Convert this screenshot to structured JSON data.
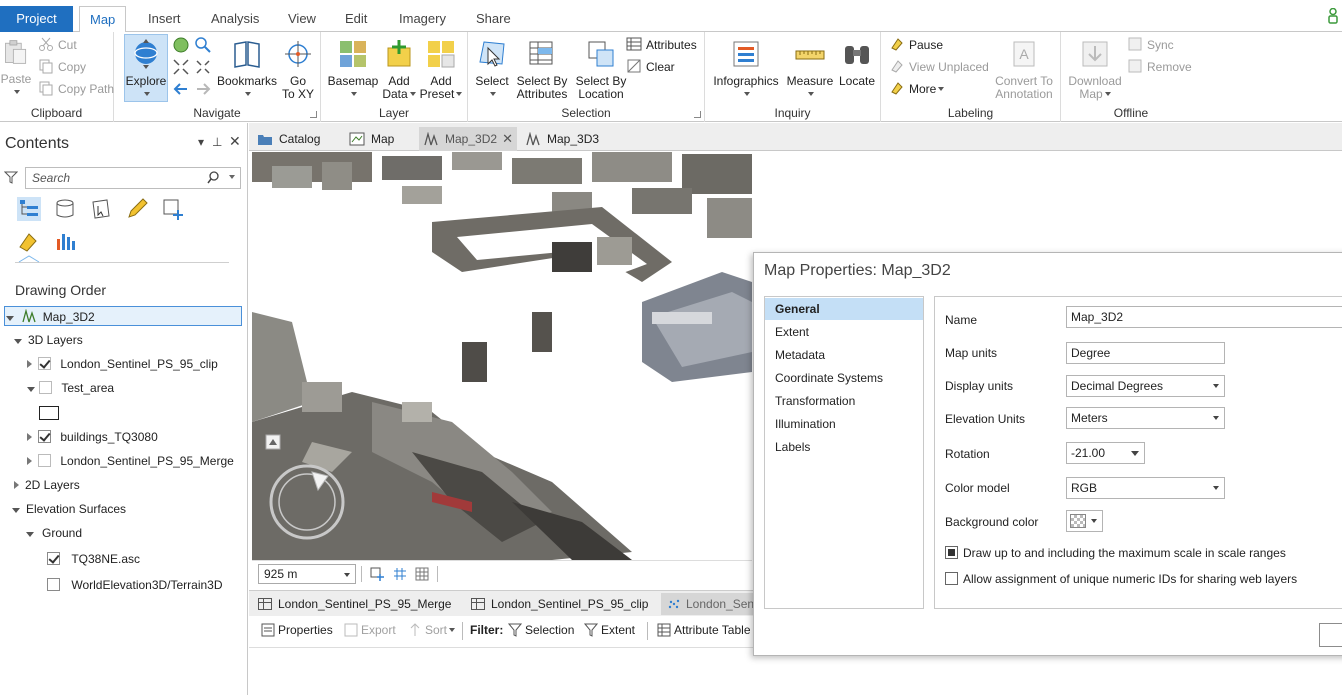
{
  "ribbon_tabs": [
    "Project",
    "Map",
    "Insert",
    "Analysis",
    "View",
    "Edit",
    "Imagery",
    "Share"
  ],
  "clipboard": {
    "paste": "Paste",
    "cut": "Cut",
    "copy": "Copy",
    "copy_path": "Copy Path",
    "group": "Clipboard"
  },
  "navigate": {
    "explore": "Explore",
    "bookmarks": "Bookmarks",
    "go_to_xy_1": "Go",
    "go_to_xy_2": "To XY",
    "group": "Navigate"
  },
  "layer": {
    "basemap": "Basemap",
    "add_data_1": "Add",
    "add_data_2": "Data",
    "add_preset_1": "Add",
    "add_preset_2": "Preset",
    "group": "Layer"
  },
  "selection": {
    "select": "Select",
    "select_by_attr_1": "Select By",
    "select_by_attr_2": "Attributes",
    "select_by_loc_1": "Select By",
    "select_by_loc_2": "Location",
    "attributes": "Attributes",
    "clear": "Clear",
    "group": "Selection"
  },
  "inquiry": {
    "infographics": "Infographics",
    "measure": "Measure",
    "locate": "Locate",
    "group": "Inquiry"
  },
  "labeling": {
    "pause": "Pause",
    "view_unplaced": "View Unplaced",
    "more": "More",
    "convert_1": "Convert To",
    "convert_2": "Annotation",
    "group": "Labeling"
  },
  "offline": {
    "download_1": "Download",
    "download_2": "Map",
    "sync": "Sync",
    "remove": "Remove",
    "group": "Offline"
  },
  "contents": {
    "title": "Contents",
    "search_placeholder": "Search",
    "drawing_order": "Drawing Order",
    "map_name": "Map_3D2",
    "layers_3d": "3D Layers",
    "layer1": "London_Sentinel_PS_95_clip",
    "layer2": "Test_area",
    "layer3": "buildings_TQ3080",
    "layer4": "London_Sentinel_PS_95_Merge",
    "layers_2d": "2D Layers",
    "elevation": "Elevation Surfaces",
    "ground": "Ground",
    "surface1": "TQ38NE.asc",
    "surface2": "WorldElevation3D/Terrain3D"
  },
  "view_tabs": [
    "Catalog",
    "Map",
    "Map_3D2",
    "Map_3D3"
  ],
  "map_scale": "925 m",
  "bottom_tabs": [
    "London_Sentinel_PS_95_Merge",
    "London_Sentinel_PS_95_clip",
    "London_Sen"
  ],
  "attr_toolbar": {
    "properties": "Properties",
    "export": "Export",
    "sort": "Sort",
    "filter": "Filter:",
    "selection": "Selection",
    "extent": "Extent",
    "attribute_table": "Attribute Table"
  },
  "dialog": {
    "title": "Map Properties: Map_3D2",
    "nav": [
      "General",
      "Extent",
      "Metadata",
      "Coordinate Systems",
      "Transformation",
      "Illumination",
      "Labels"
    ],
    "labels": {
      "name": "Name",
      "map_units": "Map units",
      "display_units": "Display units",
      "elevation_units": "Elevation Units",
      "rotation": "Rotation",
      "color_model": "Color model",
      "background_color": "Background color"
    },
    "values": {
      "name": "Map_3D2",
      "map_units": "Degree",
      "display_units": "Decimal Degrees",
      "elevation_units": "Meters",
      "rotation": "-21.00",
      "color_model": "RGB"
    },
    "checks": {
      "draw_up_to": "Draw up to and including the maximum scale in scale ranges",
      "allow_ids": "Allow assignment of unique numeric IDs for sharing web layers"
    }
  }
}
